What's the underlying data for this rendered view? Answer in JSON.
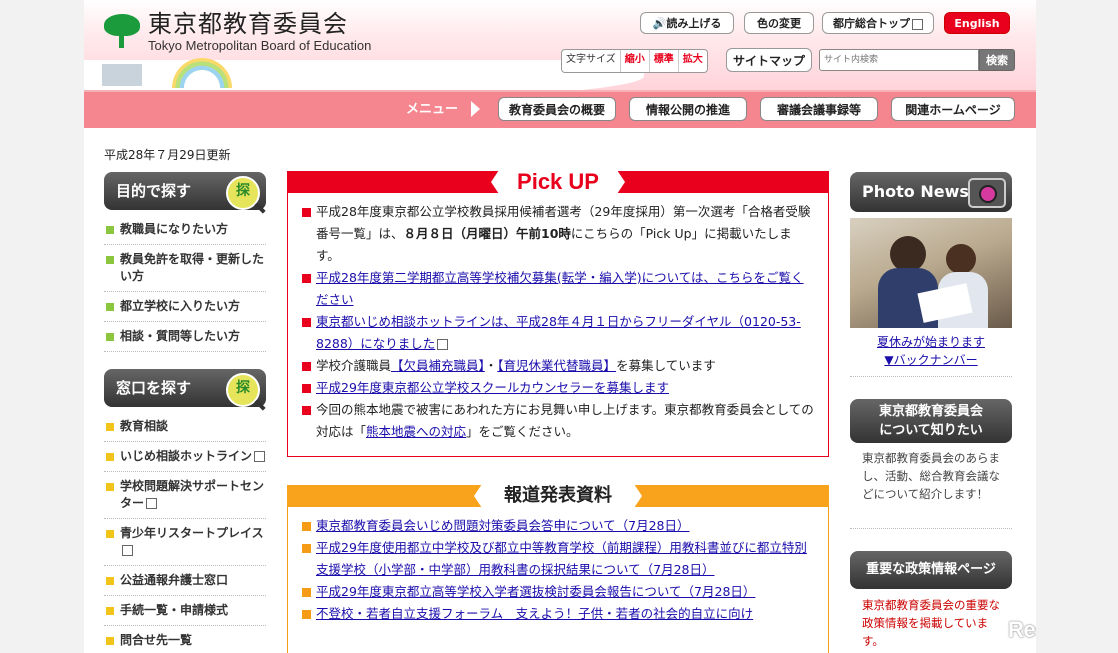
{
  "header": {
    "logo_jp": "東京都教育委員会",
    "logo_en": "Tokyo Metropolitan Board of Education",
    "buttons": {
      "read_aloud": "読み上げる",
      "color_change": "色の変更",
      "tocho_top": "都庁総合トップ",
      "english": "English",
      "sitemap": "サイトマップ"
    },
    "font_size": {
      "label": "文字サイズ",
      "small": "縮小",
      "standard": "標準",
      "large": "拡大"
    },
    "search": {
      "placeholder": "サイト内検索",
      "button": "検索"
    }
  },
  "nav": {
    "menu_label": "メニュー",
    "items": [
      "教育委員会の概要",
      "情報公開の推進",
      "審議会議事録等",
      "関連ホームページ"
    ]
  },
  "updated": "平成28年７月29日更新",
  "left": {
    "section1": {
      "title": "目的で探す",
      "badge": "探",
      "items": [
        "教職員になりたい方",
        "教員免許を取得・更新したい方",
        "都立学校に入りたい方",
        "相談・質問等したい方"
      ]
    },
    "section2": {
      "title": "窓口を探す",
      "badge": "探",
      "items": [
        "教育相談",
        "いじめ相談ホットライン",
        "学校問題解決サポートセンター",
        "青少年リスタートプレイス",
        "公益通報弁護士窓口",
        "手続一覧・申請様式",
        "問合せ先一覧"
      ]
    }
  },
  "pickup": {
    "title": "Pick UP",
    "item1": {
      "text_a": "平成28年度東京都公立学校教員採用候補者選考（29年度採用）第一次選考「合格者受験番号一覧」は、",
      "bold": "８月８日（月曜日）午前10時",
      "text_b": "にこちらの「Pick Up」に掲載いたします。"
    },
    "item2": "平成28年度第二学期都立高等学校補欠募集(転学・編入学)については、こちらをご覧ください",
    "item3": "東京都いじめ相談ホットラインは、平成28年４月１日からフリーダイヤル（0120-53-8288）になりました",
    "item4": {
      "prefix": "学校介護職員",
      "link1": "【欠員補充職員】",
      "sep": "・",
      "link2": "【育児休業代替職員】",
      "suffix": "を募集しています"
    },
    "item5": "平成29年度東京都公立学校スクールカウンセラーを募集します",
    "item6": {
      "text_a": "今回の熊本地震で被害にあわれた方にお見舞い申し上げます。東京都教育委員会としての対応は「",
      "link": "熊本地震への対応",
      "text_b": "」をご覧ください。"
    }
  },
  "press": {
    "title": "報道発表資料",
    "items": [
      "東京都教育委員会いじめ問題対策委員会答申について（7月28日）",
      "平成29年度使用都立中学校及び都立中等教育学校（前期課程）用教科書並びに都立特別支援学校（小学部・中学部）用教科書の採択結果について（7月28日）",
      "平成29年度東京都立高等学校入学者選抜検討委員会報告について（7月28日）",
      "不登校・若者自立支援フォーラム　支えよう！子供・若者の社会的自立に向け"
    ]
  },
  "right": {
    "photo_news": "Photo News",
    "caption_link": "夏休みが始まります",
    "back_number": "▼バックナンバー",
    "about_title_1": "東京都教育委員会",
    "about_title_2": "について知りたい",
    "about_text": "東京都教育委員会のあらまし、活動、総合教育会議などについて紹介します！",
    "policy_title": "重要な政策情報ページ",
    "policy_text": "東京都教育委員会の重要な政策情報を掲載しています。"
  },
  "watermark": "ReseMom",
  "colors": {
    "accent_red": "#e8001c",
    "nav_pink": "#f5858e",
    "press_orange": "#f9a21b",
    "logo_green": "#1c9b3d"
  }
}
